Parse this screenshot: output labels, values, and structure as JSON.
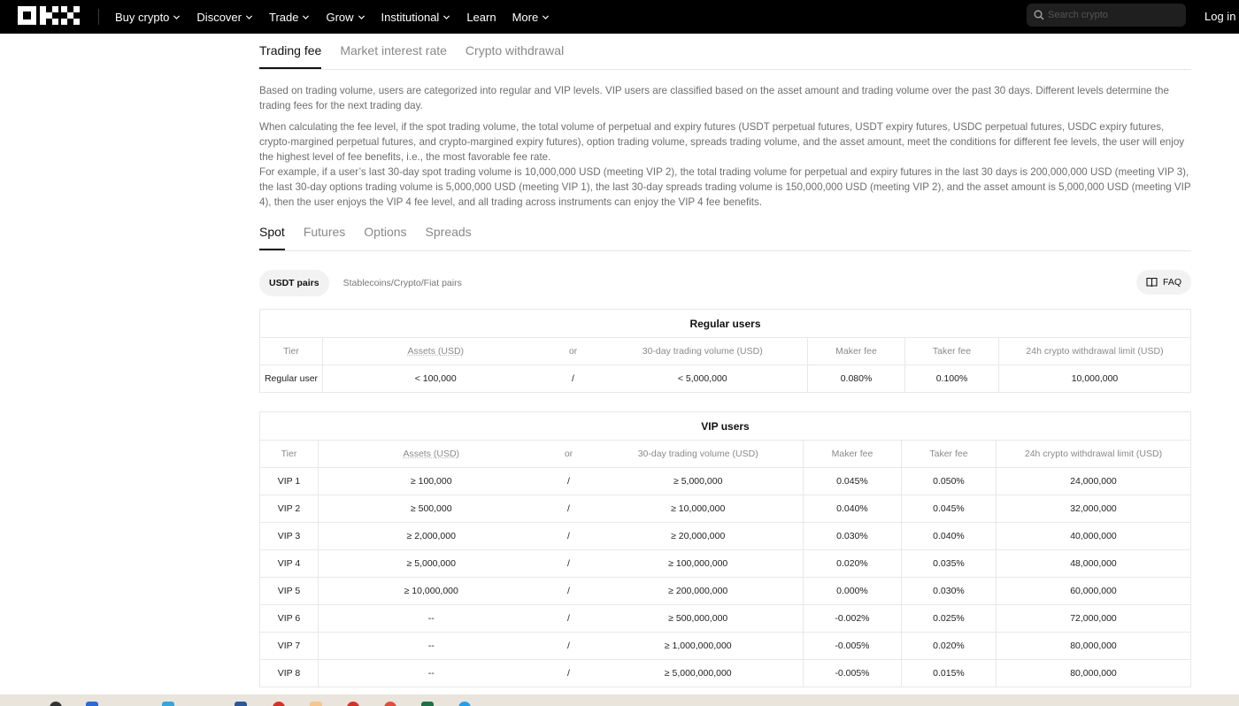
{
  "nav": {
    "menu": [
      {
        "label": "Buy crypto",
        "dropdown": true
      },
      {
        "label": "Discover",
        "dropdown": true
      },
      {
        "label": "Trade",
        "dropdown": true
      },
      {
        "label": "Grow",
        "dropdown": true
      },
      {
        "label": "Institutional",
        "dropdown": true
      },
      {
        "label": "Learn",
        "dropdown": false
      },
      {
        "label": "More",
        "dropdown": true
      }
    ],
    "search_placeholder": "Search crypto",
    "login": "Log in"
  },
  "top_tabs": [
    {
      "label": "Trading fee",
      "active": true
    },
    {
      "label": "Market interest rate",
      "active": false
    },
    {
      "label": "Crypto withdrawal",
      "active": false
    }
  ],
  "description": {
    "p1": "Based on trading volume, users are categorized into regular and VIP levels. VIP users are classified based on the asset amount and trading volume over the past 30 days. Different levels determine the trading fees for the next trading day.",
    "p2": "When calculating the fee level, if the spot trading volume, the total volume of perpetual and expiry futures (USDT perpetual futures, USDT expiry futures, USDC perpetual futures, USDC expiry futures, crypto-margined perpetual futures, and crypto-margined expiry futures), option trading volume, spreads trading volume, and the asset amount, meet the conditions for different fee levels, the user will enjoy the highest level of fee benefits, i.e., the most favorable fee rate.",
    "p3": "For example, if a user’s last 30-day spot trading volume is 10,000,000 USD (meeting VIP 2), the total trading volume for perpetual and expiry futures in the last 30 days is 200,000,000 USD (meeting VIP 3), the last 30-day options trading volume is 5,000,000 USD (meeting VIP 1), the last 30-day spreads trading volume is 150,000,000 USD (meeting VIP 2), and the asset amount is 5,000,000 USD (meeting VIP 4), then the user enjoys the VIP 4 fee level, and all trading across instruments can enjoy the VIP 4 fee benefits."
  },
  "sub_tabs": [
    {
      "label": "Spot",
      "active": true
    },
    {
      "label": "Futures",
      "active": false
    },
    {
      "label": "Options",
      "active": false
    },
    {
      "label": "Spreads",
      "active": false
    }
  ],
  "pairs": {
    "usdt": "USDT pairs",
    "stable": "Stablecoins/Crypto/Fiat pairs",
    "faq": "FAQ"
  },
  "columns": {
    "tier": "Tier",
    "assets": "Assets (USD)",
    "or": "or",
    "volume": "30-day trading volume (USD)",
    "maker": "Maker fee",
    "taker": "Taker fee",
    "limit": "24h crypto withdrawal limit (USD)"
  },
  "regular": {
    "title": "Regular users",
    "rows": [
      {
        "tier": "Regular user",
        "assets": "< 100,000",
        "sep": "/",
        "volume": "< 5,000,000",
        "maker": "0.080%",
        "taker": "0.100%",
        "limit": "10,000,000"
      }
    ]
  },
  "vip": {
    "title": "VIP users",
    "rows": [
      {
        "tier": "VIP 1",
        "assets": "≥ 100,000",
        "sep": "/",
        "volume": "≥ 5,000,000",
        "maker": "0.045%",
        "taker": "0.050%",
        "limit": "24,000,000"
      },
      {
        "tier": "VIP 2",
        "assets": "≥ 500,000",
        "sep": "/",
        "volume": "≥ 10,000,000",
        "maker": "0.040%",
        "taker": "0.045%",
        "limit": "32,000,000"
      },
      {
        "tier": "VIP 3",
        "assets": "≥ 2,000,000",
        "sep": "/",
        "volume": "≥ 20,000,000",
        "maker": "0.030%",
        "taker": "0.040%",
        "limit": "40,000,000"
      },
      {
        "tier": "VIP 4",
        "assets": "≥ 5,000,000",
        "sep": "/",
        "volume": "≥ 100,000,000",
        "maker": "0.020%",
        "taker": "0.035%",
        "limit": "48,000,000"
      },
      {
        "tier": "VIP 5",
        "assets": "≥ 10,000,000",
        "sep": "/",
        "volume": "≥ 200,000,000",
        "maker": "0.000%",
        "taker": "0.030%",
        "limit": "60,000,000"
      },
      {
        "tier": "VIP 6",
        "assets": "--",
        "sep": "/",
        "volume": "≥ 500,000,000",
        "maker": "-0.002%",
        "taker": "0.025%",
        "limit": "72,000,000"
      },
      {
        "tier": "VIP 7",
        "assets": "--",
        "sep": "/",
        "volume": "≥ 1,000,000,000",
        "maker": "-0.005%",
        "taker": "0.020%",
        "limit": "80,000,000"
      },
      {
        "tier": "VIP 8",
        "assets": "--",
        "sep": "/",
        "volume": "≥ 5,000,000,000",
        "maker": "-0.005%",
        "taker": "0.015%",
        "limit": "80,000,000"
      }
    ]
  },
  "colors": {
    "nav_bg": "#000000",
    "text_primary": "#111111",
    "text_muted": "#888888",
    "border": "#e8e8e8",
    "pill_bg": "#f2f2f2"
  }
}
